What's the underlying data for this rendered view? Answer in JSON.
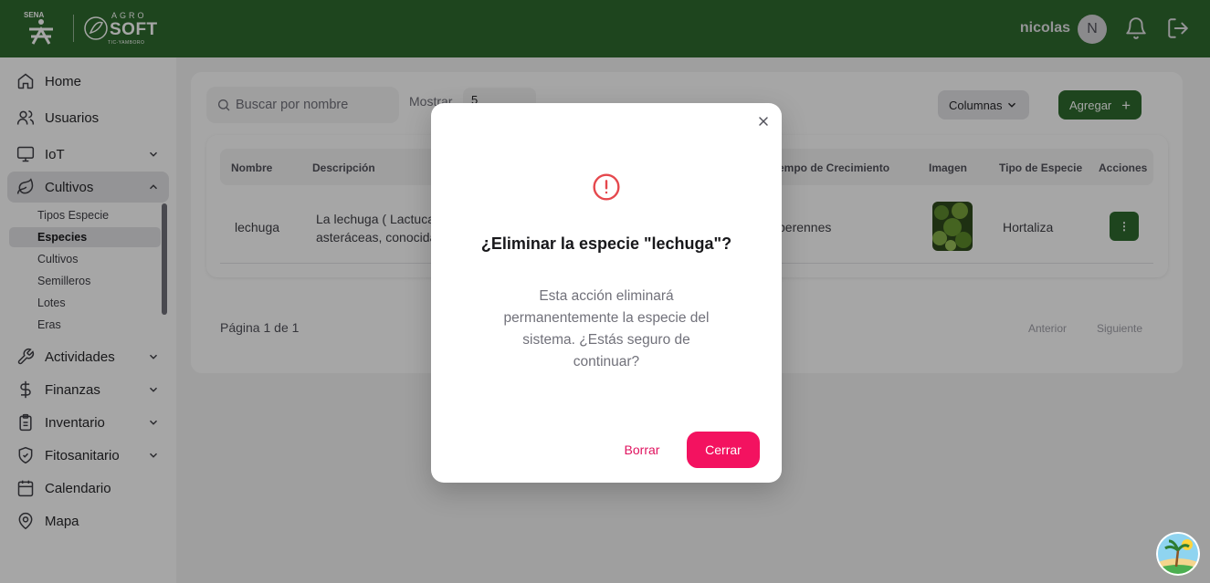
{
  "header": {
    "logo_sena": "SENA",
    "logo_agro_small": "AGRO",
    "logo_agro_big": "SOFT",
    "logo_agro_sub": "TIC-YAMBORO",
    "username": "nicolas",
    "avatar_initial": "N",
    "colors": {
      "primary": "#2e6b2e"
    }
  },
  "sidebar": {
    "items": [
      {
        "label": "Home",
        "icon": "home-icon"
      },
      {
        "label": "Usuarios",
        "icon": "users-icon"
      },
      {
        "label": "IoT",
        "icon": "monitor-icon"
      },
      {
        "label": "Cultivos",
        "icon": "leaf-icon"
      },
      {
        "label": "Actividades",
        "icon": "wrench-icon"
      },
      {
        "label": "Finanzas",
        "icon": "dollar-icon"
      },
      {
        "label": "Inventario",
        "icon": "clipboard-icon"
      },
      {
        "label": "Fitosanitario",
        "icon": "shield-icon"
      },
      {
        "label": "Calendario",
        "icon": "calendar-icon"
      },
      {
        "label": "Mapa",
        "icon": "map-pin-icon"
      }
    ],
    "cultivos_sub": [
      "Tipos Especie",
      "Especies",
      "Cultivos",
      "Semilleros",
      "Lotes",
      "Eras"
    ]
  },
  "toolbar": {
    "search_placeholder": "Buscar por nombre",
    "show_label": "Mostrar",
    "show_value": "5",
    "columns_label": "Columnas",
    "add_label": "Agregar"
  },
  "table": {
    "headers": [
      "Nombre",
      "Descripción",
      "empo de Crecimiento",
      "Imagen",
      "Tipo de Especie",
      "Acciones"
    ],
    "rows": [
      {
        "nombre": "lechuga",
        "descripcion_l1": "La lechuga ( Lactuca",
        "descripcion_l2": "asteráceas, conocida",
        "tiempo": "perennes",
        "tipo": "Hortaliza",
        "actions": "⋮"
      }
    ]
  },
  "pagination": {
    "text": "Página 1 de 1",
    "prev": "Anterior",
    "next": "Siguiente"
  },
  "modal": {
    "title": "¿Eliminar la especie \"lechuga\"?",
    "body": "Esta acción eliminará permanentemente la especie del sistema. ¿Estás seguro de continuar?",
    "delete_label": "Borrar",
    "close_label": "Cerrar",
    "colors": {
      "danger": "#f31260"
    }
  }
}
